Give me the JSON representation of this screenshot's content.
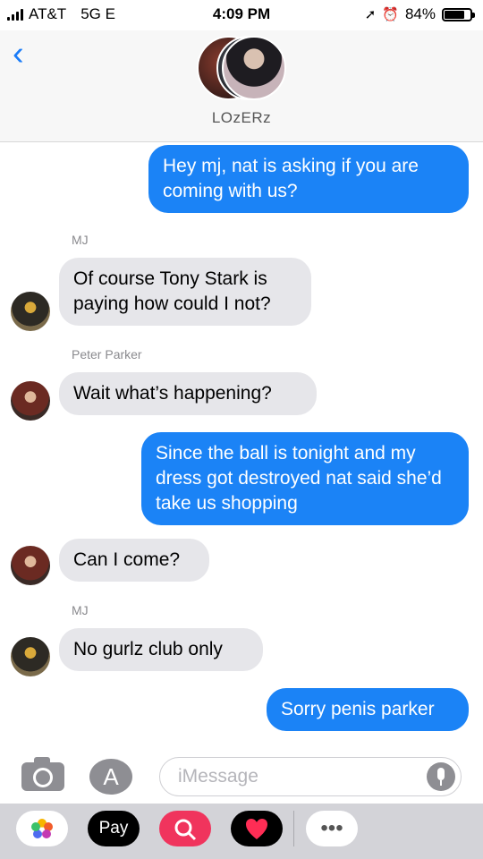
{
  "status": {
    "carrier": "AT&T",
    "network": "5G E",
    "time": "4:09 PM",
    "battery": "84%",
    "battery_level": 0.84,
    "icons": [
      "signal-bars-icon",
      "location-arrow-icon",
      "alarm-icon",
      "battery-icon"
    ]
  },
  "header": {
    "back_icon": "‹",
    "group_name": "LOzERz"
  },
  "thread": {
    "messages": [
      {
        "direction": "outgoing",
        "text": "Hey mj, nat is asking if you are coming with us?"
      },
      {
        "direction": "incoming",
        "sender": "MJ",
        "text": "Of course Tony Stark is paying how could I not?"
      },
      {
        "direction": "incoming",
        "sender": "Peter Parker",
        "text": "Wait what’s happening?"
      },
      {
        "direction": "outgoing",
        "text": "Since the ball is tonight and my dress got destroyed nat said she’d take us shopping"
      },
      {
        "direction": "incoming",
        "text": "Can I come?"
      },
      {
        "direction": "incoming",
        "sender": "MJ",
        "text": "No gurlz club only"
      },
      {
        "direction": "outgoing",
        "text": "Sorry penis parker"
      }
    ]
  },
  "composer": {
    "placeholder": "iMessage",
    "appstore_icon": "A"
  },
  "app_drawer": {
    "pay_label": " Pay",
    "more_icon": "•••",
    "apps": [
      "photos-app-icon",
      "apple-pay-app-icon",
      "search-images-app-icon",
      "digital-touch-app-icon",
      "more-apps-icon"
    ]
  },
  "colors": {
    "outgoing_bubble": "#1b83f6",
    "incoming_bubble": "#e6e6ea",
    "accent": "#1a7cf8"
  }
}
